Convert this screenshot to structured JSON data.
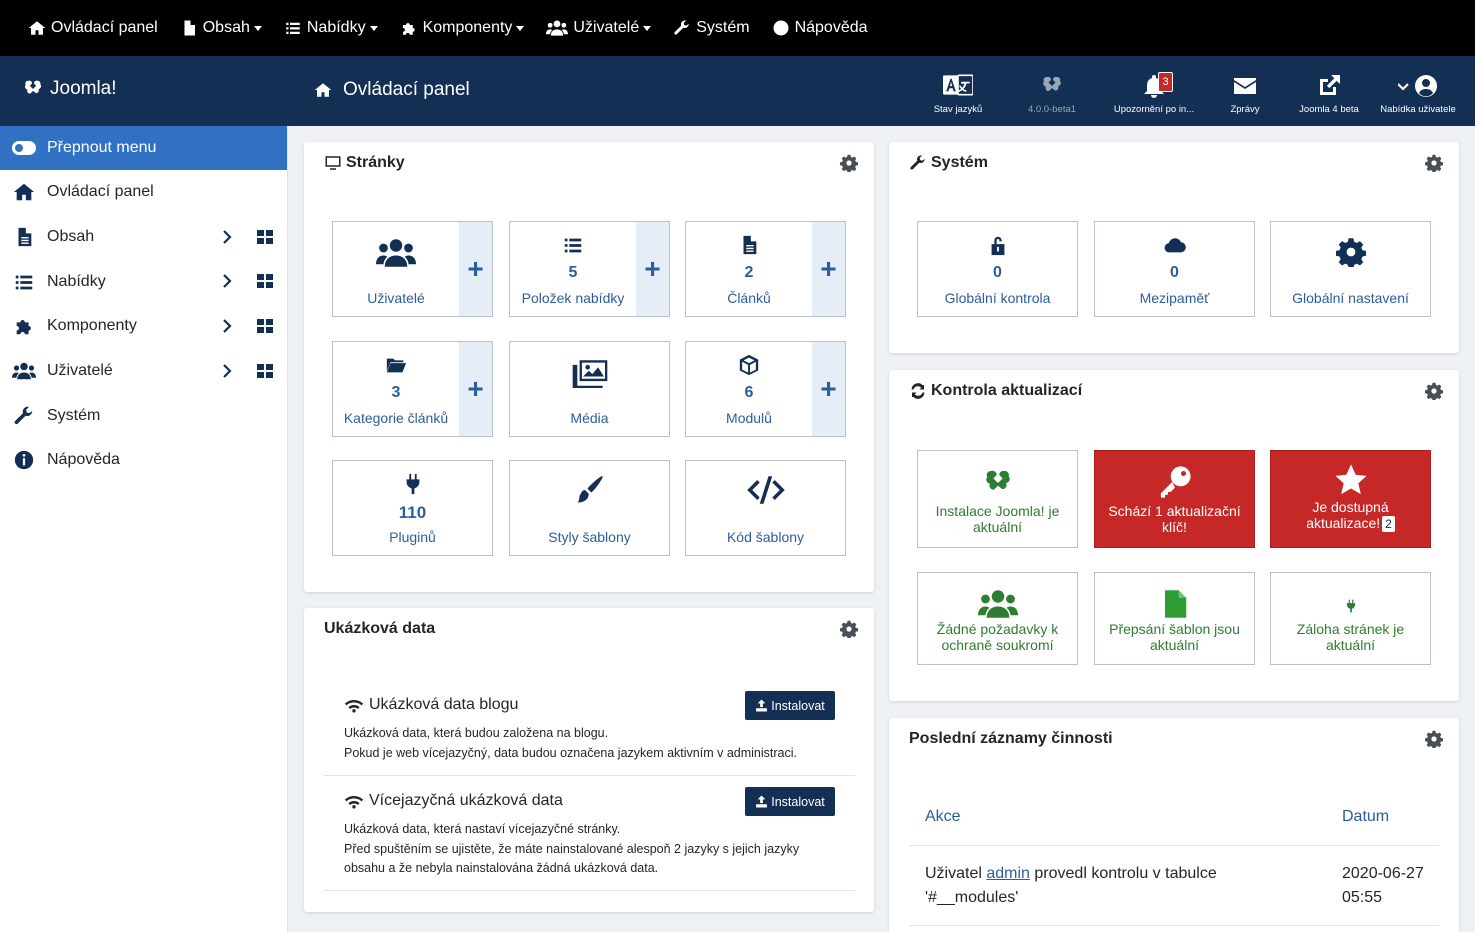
{
  "topmenu": [
    {
      "label": "Ovládací panel",
      "icon": "home-icon",
      "dropdown": false
    },
    {
      "label": "Obsah",
      "icon": "file-icon",
      "dropdown": true
    },
    {
      "label": "Nabídky",
      "icon": "list-icon",
      "dropdown": true
    },
    {
      "label": "Komponenty",
      "icon": "puzzle-icon",
      "dropdown": true
    },
    {
      "label": "Uživatelé",
      "icon": "users-icon",
      "dropdown": true
    },
    {
      "label": "Systém",
      "icon": "wrench-icon",
      "dropdown": false
    },
    {
      "label": "Nápověda",
      "icon": "info-icon",
      "dropdown": false
    }
  ],
  "header": {
    "logo_text": "Joomla!",
    "page_title": "Ovládací panel",
    "icons": {
      "language": "Stav jazyků",
      "version": "4.0.0-beta1",
      "notifications": "Upozornění po in...",
      "notifications_count": "3",
      "messages": "Zprávy",
      "joomla4": "Joomla 4 beta",
      "user_menu": "Nabídka uživatele"
    }
  },
  "sidebar": {
    "toggle_label": "Přepnout menu",
    "items": [
      {
        "label": "Ovládací panel"
      },
      {
        "label": "Obsah"
      },
      {
        "label": "Nabídky"
      },
      {
        "label": "Komponenty"
      },
      {
        "label": "Uživatelé"
      },
      {
        "label": "Systém"
      },
      {
        "label": "Nápověda"
      }
    ]
  },
  "sites": {
    "title": "Stránky",
    "tiles": {
      "users": {
        "label": "Uživatelé"
      },
      "menu_items": {
        "count": "5",
        "label": "Položek nabídky"
      },
      "articles": {
        "count": "2",
        "label": "Článků"
      },
      "categories": {
        "count": "3",
        "label": "Kategorie článků"
      },
      "media": {
        "label": "Média"
      },
      "modules": {
        "count": "6",
        "label": "Modulů"
      },
      "plugins": {
        "count": "110",
        "label": "Pluginů"
      },
      "template_styles": {
        "label": "Styly šablony"
      },
      "template_code": {
        "label": "Kód šablony"
      }
    },
    "plus": "+"
  },
  "system": {
    "title": "Systém",
    "tiles": {
      "checkin": {
        "count": "0",
        "label": "Globální kontrola"
      },
      "cache": {
        "count": "0",
        "label": "Mezipaměť"
      },
      "config": {
        "label": "Globální nastavení"
      }
    }
  },
  "updates": {
    "title": "Kontrola aktualizací",
    "tiles": {
      "joomla": {
        "label": "Instalace Joomla! je aktuální"
      },
      "missing_key": {
        "label": "Schází 1 aktualizační klíč!"
      },
      "available": {
        "label": "Je dostupná aktualizace!",
        "count": "2"
      },
      "privacy": {
        "label": "Žádné požadavky k ochraně soukromí"
      },
      "overrides": {
        "label": "Přepsání šablon jsou aktuální"
      },
      "backup": {
        "label": "Záloha stránek je aktuální"
      }
    }
  },
  "sample_data": {
    "title": "Ukázková data",
    "install_label": "Instalovat",
    "items": [
      {
        "name": "Ukázková data blogu",
        "desc1": "Ukázková data, která budou založena na blogu.",
        "desc2": "Pokud je web vícejazyčný, data budou označena jazykem aktivním v administraci."
      },
      {
        "name": "Vícejazyčná ukázková data",
        "desc1": "Ukázková data, která nastaví vícejazyčné stránky.",
        "desc2": "Před spuštěním se ujistěte, že máte nainstalované alespoň 2 jazyky s jejich jazyky obsahu a že nebyla nainstalována žádná ukázková data."
      }
    ]
  },
  "activity": {
    "title": "Poslední záznamy činnosti",
    "col_action": "Akce",
    "col_date": "Datum",
    "rows": [
      {
        "prefix": "Uživatel",
        "user": "admin",
        "text": "provedl kontrolu v tabulce",
        "table": "'#__modules'",
        "date": "2020-06-27",
        "time": "05:55"
      }
    ]
  },
  "colors": {
    "topbar": "#000000",
    "header": "#132f53",
    "accent": "#3071c3",
    "link": "#2b5e9e",
    "danger": "#c52827",
    "success": "#2e7d32"
  }
}
